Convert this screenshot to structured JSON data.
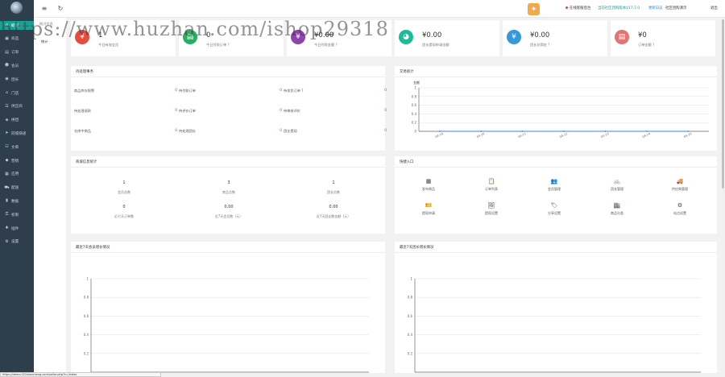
{
  "sidebar": {
    "items": [
      {
        "label": "概况",
        "icon": "home-icon"
      },
      {
        "label": "商品",
        "icon": "box-icon"
      },
      {
        "label": "订单",
        "icon": "order-icon"
      },
      {
        "label": "会员",
        "icon": "user-icon"
      },
      {
        "label": "团长",
        "icon": "leader-icon"
      },
      {
        "label": "门店",
        "icon": "store-icon"
      },
      {
        "label": "供应商",
        "icon": "supplier-icon"
      },
      {
        "label": "拼团",
        "icon": "group-icon"
      },
      {
        "label": "同城快递",
        "icon": "delivery-icon"
      },
      {
        "label": "文章",
        "icon": "article-icon"
      },
      {
        "label": "营销",
        "icon": "marketing-icon"
      },
      {
        "label": "应用",
        "icon": "app-icon"
      },
      {
        "label": "配送",
        "icon": "truck-icon"
      },
      {
        "label": "数据",
        "icon": "data-icon"
      },
      {
        "label": "权限",
        "icon": "permission-icon"
      },
      {
        "label": "插件",
        "icon": "plugin-icon"
      },
      {
        "label": "设置",
        "icon": "settings-icon"
      }
    ]
  },
  "submenu": {
    "title": "概况信息",
    "item": "统计"
  },
  "topbar": {
    "online": "在线客服后台",
    "version": "当前社区团购版本V17.7.0",
    "update": "更新日志",
    "shop": "社区团购演示",
    "logout": "退出"
  },
  "stats": [
    {
      "value": "1",
      "label": "今日有效会员",
      "color": "#e74c3c",
      "icon": "money-bag-icon"
    },
    {
      "value": "0",
      "label": "今日付款订单 ?",
      "color": "#27ae60",
      "icon": "document-icon"
    },
    {
      "value": "¥0.00",
      "label": "今日付款金额 ?",
      "color": "#8e44ad",
      "icon": "coin-bag-icon"
    },
    {
      "value": "¥0.00",
      "label": "团长提现申请金额",
      "color": "#1abc9c",
      "icon": "wallet-icon"
    },
    {
      "value": "¥0.00",
      "label": "团长总佣金 ?",
      "color": "#3498db",
      "icon": "piggy-bank-icon"
    },
    {
      "value": "¥0",
      "label": "订单金额 ?",
      "color": "#e57373",
      "icon": "cart-icon"
    }
  ],
  "todo": {
    "title": "待处理事务",
    "cells": [
      {
        "label": "商品库存报警",
        "value": "0"
      },
      {
        "label": "待付款订单",
        "value": "0"
      },
      {
        "label": "待发货订单 ?",
        "value": "0"
      },
      {
        "label": "待处理退款",
        "value": "0"
      },
      {
        "label": "待评价订单",
        "value": "0"
      },
      {
        "label": "待审核评价",
        "value": "0"
      },
      {
        "label": "仓库中商品",
        "value": "0"
      },
      {
        "label": "待处理团长",
        "value": "0"
      },
      {
        "label": "团长提现",
        "value": "0"
      }
    ]
  },
  "trade": {
    "title": "交易统计",
    "unit": "金额",
    "chart_data": {
      "type": "line",
      "x": [
        "04-19",
        "04-20",
        "04-21",
        "04-22",
        "04-23",
        "04-24",
        "04-25"
      ],
      "series": [
        {
          "values": [
            0,
            0,
            0,
            0,
            0,
            0,
            0
          ]
        }
      ],
      "yticks": [
        "1",
        "0.8",
        "0.6",
        "0.4",
        "0.2",
        "0"
      ],
      "ylim": [
        0,
        1
      ],
      "grid": true
    }
  },
  "business": {
    "title": "商城信息统计",
    "cells": [
      {
        "value": "1",
        "label": "会员总数"
      },
      {
        "value": "3",
        "label": "商品总数"
      },
      {
        "value": "1",
        "label": "团长总数"
      },
      {
        "value": "0",
        "label": "近七天订单数"
      },
      {
        "value": "0.00",
        "label": "近7天会员数（元）"
      },
      {
        "value": "0.00",
        "label": "近7天团长数金额（元）"
      }
    ]
  },
  "quick": {
    "title": "快捷入口",
    "items": [
      {
        "label": "发布商品",
        "icon": "grid-icon",
        "glyph": "▦"
      },
      {
        "label": "订单列表",
        "icon": "clipboard-icon",
        "glyph": "📋"
      },
      {
        "label": "会员管理",
        "icon": "users-icon",
        "glyph": "👥"
      },
      {
        "label": "团长管理",
        "icon": "bicycle-icon",
        "glyph": "🚲"
      },
      {
        "label": "供应商管理",
        "icon": "truck-icon",
        "glyph": "🚚"
      },
      {
        "label": "提现申请",
        "icon": "ticket-icon",
        "glyph": "🎫"
      },
      {
        "label": "提现设置",
        "icon": "image-icon",
        "glyph": "🖼"
      },
      {
        "label": "分享设置",
        "icon": "tag-icon",
        "glyph": "🏷"
      },
      {
        "label": "商品分类",
        "icon": "storefront-icon",
        "glyph": "🏬"
      },
      {
        "label": "站点设置",
        "icon": "gear-icon",
        "glyph": "⚙"
      }
    ]
  },
  "member_growth": {
    "title": "最近7天会员增长情况",
    "chart_data": {
      "type": "line",
      "yticks": [
        "1",
        "0.8",
        "0.6",
        "0.4",
        "0.2"
      ],
      "ylim": [
        0,
        1
      ],
      "series": []
    }
  },
  "leader_growth": {
    "title": "最近7天团长增长情况",
    "chart_data": {
      "type": "line",
      "yticks": [
        "1",
        "0.8",
        "0.6",
        "0.4",
        "0.2"
      ],
      "ylim": [
        0,
        1
      ],
      "series": []
    }
  },
  "statusbar": "https://demo.022xiaocheng.com/seller.php?s=/index",
  "watermark": "https://www.huzhan.com/ishop29318"
}
